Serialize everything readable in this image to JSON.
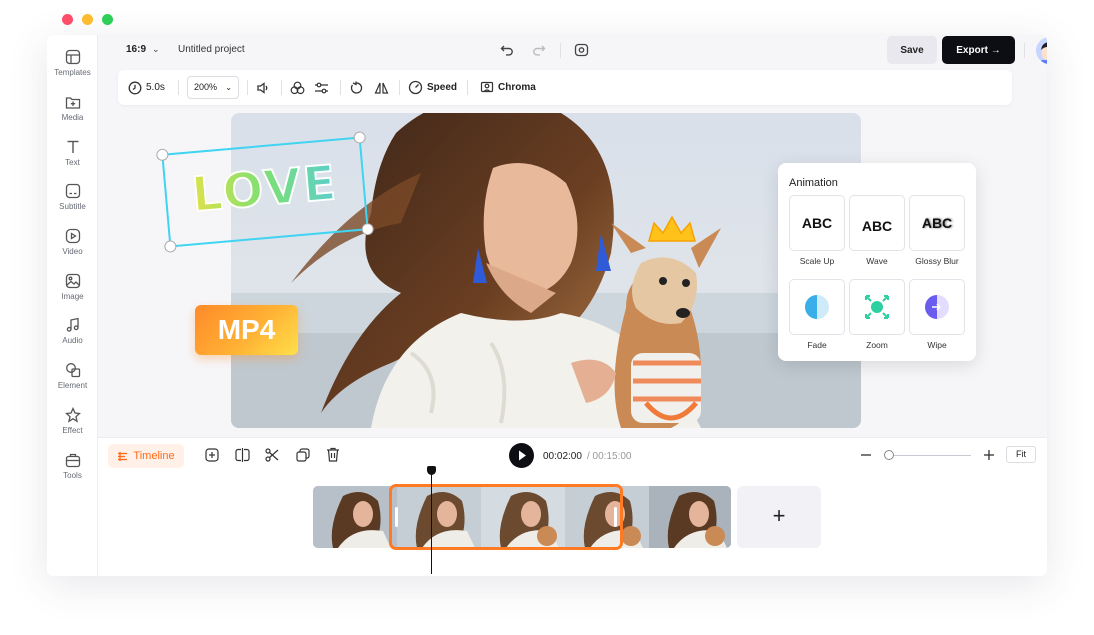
{
  "window": {
    "dot_colors": [
      "#ff4f6a",
      "#ffbe2e",
      "#2ed158"
    ]
  },
  "sidebar": {
    "items": [
      {
        "label": "Templates",
        "icon": "templates-icon"
      },
      {
        "label": "Media",
        "icon": "media-icon"
      },
      {
        "label": "Text",
        "icon": "text-icon"
      },
      {
        "label": "Subtitle",
        "icon": "subtitle-icon"
      },
      {
        "label": "Video",
        "icon": "video-icon"
      },
      {
        "label": "Image",
        "icon": "image-icon"
      },
      {
        "label": "Audio",
        "icon": "audio-icon"
      },
      {
        "label": "Element",
        "icon": "element-icon"
      },
      {
        "label": "Effect",
        "icon": "effect-icon"
      },
      {
        "label": "Tools",
        "icon": "tools-icon"
      }
    ]
  },
  "topbar": {
    "aspect_ratio": "16:9",
    "project_name": "Untitled project",
    "save_label": "Save",
    "export_label": "Export"
  },
  "toolbar": {
    "duration": "5.0s",
    "zoom": "200%",
    "speed_label": "Speed",
    "chroma_label": "Chroma"
  },
  "canvas": {
    "text_overlay": "LOVE",
    "format_badge": "MP4"
  },
  "animation_panel": {
    "title": "Animation",
    "options": [
      {
        "label": "Scale Up",
        "preview": "ABC"
      },
      {
        "label": "Wave",
        "preview": "ABC"
      },
      {
        "label": "Glossy Blur",
        "preview": "ABC"
      },
      {
        "label": "Fade",
        "preview": ""
      },
      {
        "label": "Zoom",
        "preview": ""
      },
      {
        "label": "Wipe",
        "preview": ""
      }
    ]
  },
  "timeline": {
    "label": "Timeline",
    "current_time": "00:02:00",
    "total_time": "/ 00:15:00",
    "fit_label": "Fit",
    "add_label": "+",
    "accent_color": "#ff7a22"
  }
}
